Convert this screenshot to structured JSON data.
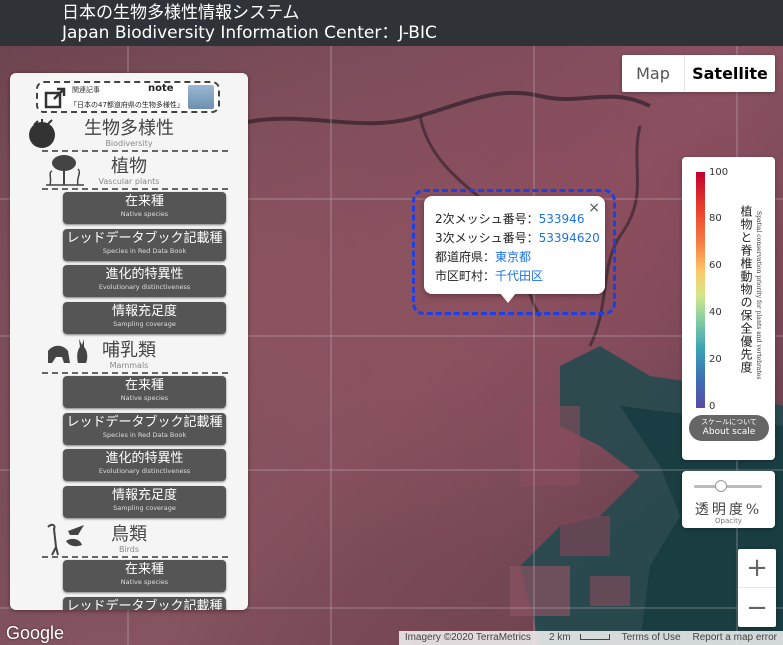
{
  "header": {
    "title_jp": "日本の生物多様性情報システム",
    "title_en": "Japan Biodiversity Information Center：J-BIC"
  },
  "note_banner": {
    "label": "関連記事",
    "brand": "note",
    "article": "「日本の47都道府県の生物多様性」"
  },
  "sections": {
    "biodiversity": {
      "jp": "生物多様性",
      "en": "Biodiversity"
    },
    "plants": {
      "jp": "植物",
      "en": "Vascular plants"
    },
    "mammals": {
      "jp": "哺乳類",
      "en": "Mammals"
    },
    "birds": {
      "jp": "鳥類",
      "en": "Birds"
    }
  },
  "buttons": {
    "native": {
      "jp": "在来種",
      "en": "Native species"
    },
    "redlist": {
      "jp": "レッドデータブック記載種",
      "en": "Species in Red Data Book"
    },
    "evolutionary": {
      "jp": "進化的特異性",
      "en": "Evolutionary distinctiveness"
    },
    "sampling": {
      "jp": "情報充足度",
      "en": "Sampling coverage"
    }
  },
  "map_type": {
    "map": "Map",
    "satellite": "Satellite",
    "selected": "Satellite"
  },
  "legend": {
    "ticks": [
      "100",
      "80",
      "60",
      "40",
      "20",
      "0"
    ],
    "title_jp": "植物と脊椎動物の保全優先度",
    "title_en": "Spatial conservation priority for plants and vertebrates",
    "about_jp": "スケールについて",
    "about_en": "About scale"
  },
  "opacity": {
    "label_jp": "透明度%",
    "label_en": "Opacity",
    "value": 0.5
  },
  "zoom": {
    "in": "+",
    "out": "−"
  },
  "popup": {
    "close": "×",
    "rows": [
      {
        "label": "2次メッシュ番号：",
        "value": "533946"
      },
      {
        "label": "3次メッシュ番号：",
        "value": "53394620"
      },
      {
        "label": "都道府県：",
        "value": "東京都"
      },
      {
        "label": "市区町村：",
        "value": "千代田区"
      }
    ]
  },
  "footer": {
    "google": "Google",
    "imagery": "Imagery ©2020 TerraMetrics",
    "scale": "2 km",
    "terms": "Terms of Use",
    "report": "Report a map error"
  },
  "colors": {
    "header_bg": "#2f3338",
    "button_bg": "#555555",
    "popup_outline": "#1f3fe6",
    "link": "#1a73e8"
  }
}
